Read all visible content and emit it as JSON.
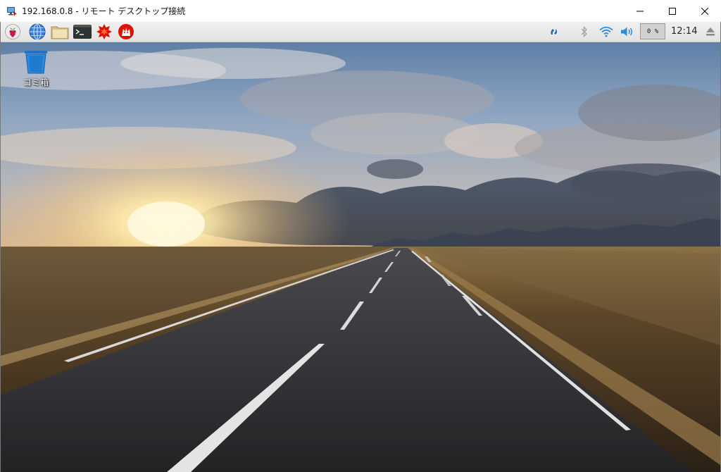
{
  "window": {
    "title": "192.168.0.8 - リモート デスクトップ接続",
    "rdp_icon": "remote-desktop-icon",
    "controls": [
      "minimize-icon",
      "maximize-icon",
      "close-icon"
    ]
  },
  "panel": {
    "launchers": [
      {
        "name": "raspberry-menu-icon"
      },
      {
        "name": "web-browser-icon"
      },
      {
        "name": "file-manager-icon"
      },
      {
        "name": "terminal-icon"
      },
      {
        "name": "mathematica-icon"
      },
      {
        "name": "wolfram-icon"
      }
    ],
    "tray": {
      "vnc_icon": "vnc-icon",
      "bluetooth_icon": "bluetooth-icon",
      "wifi_icon": "wifi-icon",
      "volume_icon": "volume-icon",
      "cpu_usage": "0 %",
      "clock": "12:14",
      "eject_icon": "eject-icon"
    }
  },
  "desktop": {
    "icons": [
      {
        "label": "ゴミ箱",
        "icon": "trash-icon"
      }
    ],
    "colors": {
      "sky_top": "#5f7fa6",
      "sun": "#fff3c4",
      "road": "#2a2a2c",
      "field": "#6b5230"
    }
  }
}
